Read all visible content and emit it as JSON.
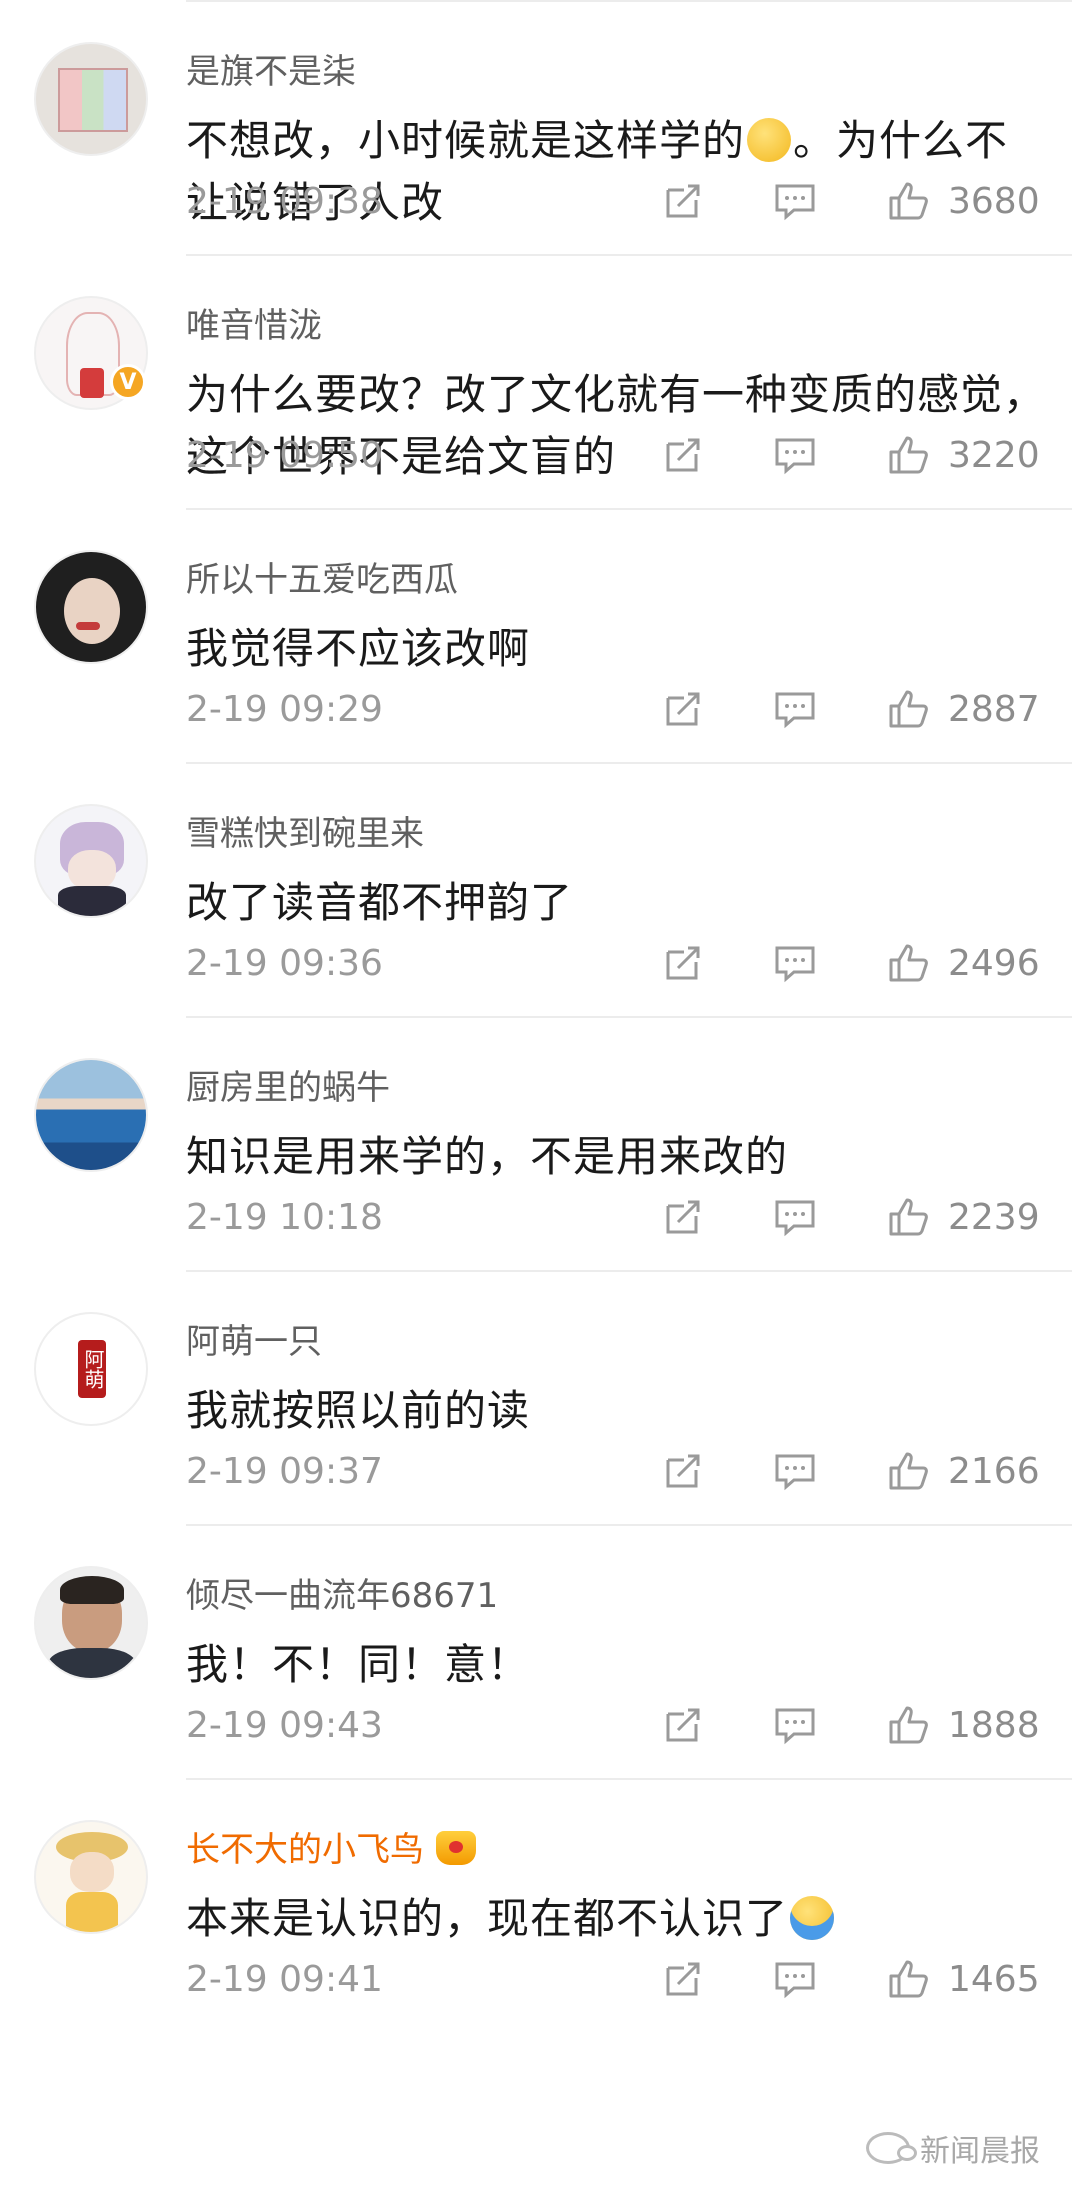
{
  "comments": [
    {
      "user": "是旗不是柒",
      "text": "不想改，小时候就是这样学的",
      "text_after_emoji": "。为什么不让说错了人改",
      "time": "2-19 09:38",
      "likes": "3680",
      "emoji": "thinking-face"
    },
    {
      "user": "唯音惜泷",
      "text": "为什么要改？改了文化就有一种变质的感觉，这个世界不是给文盲的",
      "time": "2-19 09:50",
      "likes": "3220",
      "verified": "V"
    },
    {
      "user": "所以十五爱吃西瓜",
      "text": "我觉得不应该改啊",
      "time": "2-19 09:29",
      "likes": "2887"
    },
    {
      "user": "雪糕快到碗里来",
      "text": "改了读音都不押韵了",
      "time": "2-19 09:36",
      "likes": "2496"
    },
    {
      "user": "厨房里的蜗牛",
      "text": "知识是用来学的，不是用来改的",
      "time": "2-19 10:18",
      "likes": "2239"
    },
    {
      "user": "阿萌一只",
      "text": "我就按照以前的读",
      "time": "2-19 09:37",
      "likes": "2166",
      "avatar_text": "阿萌"
    },
    {
      "user": "倾尽一曲流年68671",
      "text": "我！不！同！意！",
      "time": "2-19 09:43",
      "likes": "1888"
    },
    {
      "user": "长不大的小飞鸟",
      "text": "本来是认识的，现在都不认识了",
      "time": "2-19 09:41",
      "likes": "1465",
      "emoji": "shrug-emoji",
      "vip": "crown-icon"
    }
  ],
  "watermark": "新闻晨报",
  "colors": {
    "vip_name": "#f06b00",
    "verified": "#f5a623",
    "meta": "#9a9a9a"
  }
}
